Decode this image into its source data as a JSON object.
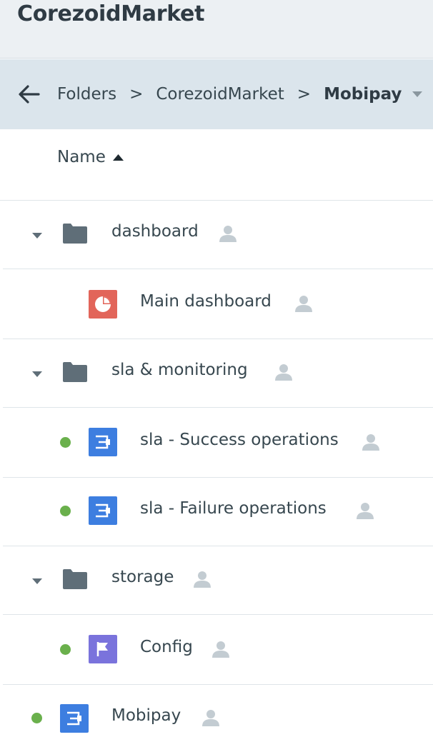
{
  "app": {
    "title": "CorezoidMarket"
  },
  "breadcrumb": {
    "items": [
      "Folders",
      "CorezoidMarket",
      "Mobipay"
    ],
    "separator": ">"
  },
  "table": {
    "column_name": "Name",
    "sort": "ascending",
    "rows": [
      {
        "label": "dashboard",
        "type": "folder",
        "expanded": true,
        "owner_icon": "user-icon"
      },
      {
        "label": "Main dashboard",
        "type": "dashboard",
        "owner_icon": "user-icon"
      },
      {
        "label": "sla & monitoring",
        "type": "folder",
        "expanded": true,
        "owner_icon": "user-icon"
      },
      {
        "label": "sla - Success operations",
        "type": "process",
        "status": "active",
        "owner_icon": "user-icon"
      },
      {
        "label": "sla - Failure operations",
        "type": "process",
        "status": "active",
        "owner_icon": "user-icon"
      },
      {
        "label": "storage",
        "type": "folder",
        "expanded": true,
        "owner_icon": "user-icon"
      },
      {
        "label": "Config",
        "type": "state-diagram",
        "status": "active",
        "owner_icon": "user-icon"
      },
      {
        "label": "Mobipay",
        "type": "process",
        "status": "active",
        "owner_icon": "user-icon"
      }
    ]
  },
  "colors": {
    "header_bg": "#ecf0f3",
    "breadcrumb_bg": "#dbe5ec",
    "folder": "#5f6e78",
    "dashboard_tile": "#e2655a",
    "process_tile": "#3d7ee0",
    "state_tile": "#7a73dc",
    "status_active": "#6ab04c",
    "user_icon": "#c3ccd2"
  }
}
